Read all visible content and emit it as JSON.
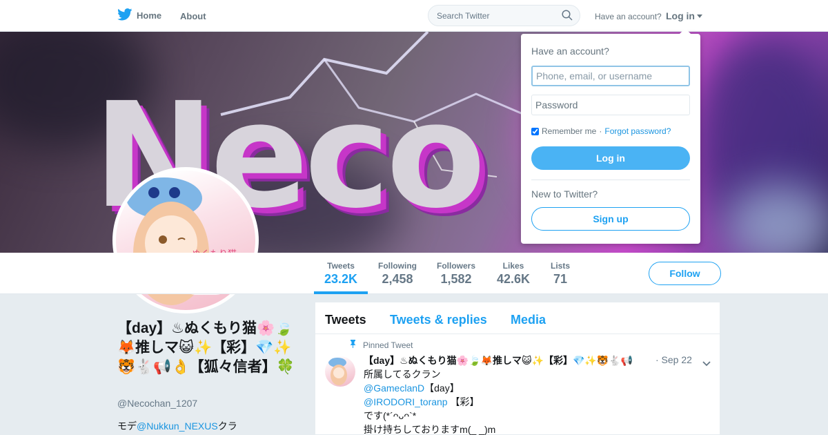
{
  "colors": {
    "brand": "#1da1f2",
    "text_muted": "#657786",
    "button_blue": "#4ab3f4"
  },
  "topnav": {
    "home_label": "Home",
    "about_label": "About",
    "search_placeholder": "Search Twitter",
    "have_account": "Have an account?",
    "login_label": "Log in",
    "icons": [
      "twitter-bird-icon",
      "search-icon",
      "caret-down-icon"
    ]
  },
  "banner": {
    "text": "Neco"
  },
  "profile": {
    "name": "【day】♨ぬくもり猫🌸🍃🦊推しマ😺✨【彩】💎✨🐯🐇📢👌【狐々信者】🍀",
    "handle": "@Necochan_1207",
    "bio_prefix": "モデ",
    "bio_link": "@Nukkun_NEXUS",
    "bio_suffix": "クラ"
  },
  "stats": [
    {
      "label": "Tweets",
      "value": "23.2K"
    },
    {
      "label": "Following",
      "value": "2,458"
    },
    {
      "label": "Followers",
      "value": "1,582"
    },
    {
      "label": "Likes",
      "value": "42.6K"
    },
    {
      "label": "Lists",
      "value": "71"
    }
  ],
  "follow_label": "Follow",
  "timeline": {
    "tabs": [
      "Tweets",
      "Tweets & replies",
      "Media"
    ],
    "tweet": {
      "pinned_label": "Pinned Tweet",
      "header": "【day】♨ぬくもり猫🌸🍃🦊推しマ😺✨【彩】💎✨🐯🐇📢",
      "date": "· Sep 22",
      "line1": "所属してるクラン",
      "line2_link": "@GameclanD",
      "line2_suffix": "【day】",
      "line3_link": "@IRODORI_toranp",
      "line3_suffix": " 【彩】",
      "line4": "です(*´ᴖᴗᴖ`*",
      "line5": "掛け持ちしておりますm(_ _)m"
    }
  },
  "login_dropdown": {
    "title": "Have an account?",
    "username_placeholder": "Phone, email, or username",
    "password_placeholder": "Password",
    "remember_label": "Remember me",
    "separator": " · ",
    "forgot_label": "Forgot password?",
    "login_button": "Log in",
    "new_label": "New to Twitter?",
    "signup_button": "Sign up"
  }
}
